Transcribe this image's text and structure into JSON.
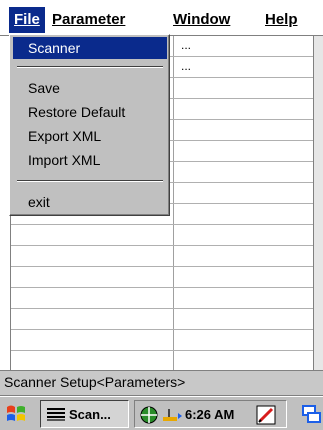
{
  "menubar": {
    "items": [
      {
        "label": "File",
        "active": true
      },
      {
        "label": "Parameter"
      },
      {
        "label": "Window"
      },
      {
        "label": "Help"
      }
    ]
  },
  "grid": {
    "values": [
      "...",
      "..."
    ]
  },
  "file_menu": {
    "items": [
      {
        "label": "Scanner"
      },
      {
        "label": "Save"
      },
      {
        "label": "Restore Default"
      },
      {
        "label": "Export XML"
      },
      {
        "label": "Import XML"
      },
      {
        "label": "exit"
      }
    ]
  },
  "status": {
    "text": "Scanner Setup<Parameters>"
  },
  "taskbar": {
    "task_label": "Scan...",
    "time": "6:26 AM",
    "icons": [
      "windows-start-icon",
      "scanner-app-icon",
      "globe-icon",
      "connection-arrow-icon",
      "pen-icon",
      "window-switch-icon"
    ]
  }
}
